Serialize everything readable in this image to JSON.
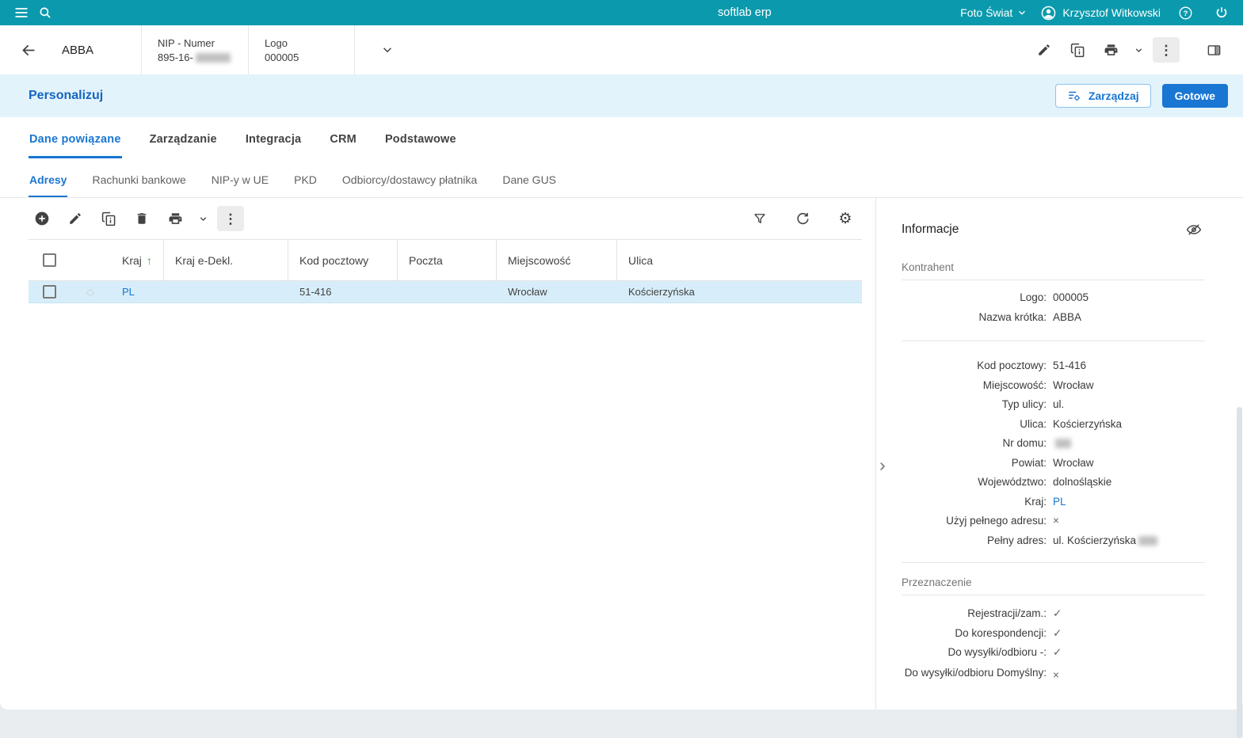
{
  "accent": "#1976d2",
  "topbar": {
    "app_title": "softlab erp",
    "company_selector": "Foto Świat",
    "user_name": "Krzysztof Witkowski"
  },
  "header": {
    "title": "ABBA",
    "nip": {
      "label": "NIP - Numer",
      "value_visible": "895-16-"
    },
    "logo": {
      "label": "Logo",
      "value": "000005"
    }
  },
  "personalize_bar": {
    "title": "Personalizuj",
    "manage_button": "Zarządzaj",
    "done_button": "Gotowe"
  },
  "main_tabs": [
    {
      "label": "Dane powiązane",
      "active": true
    },
    {
      "label": "Zarządzanie",
      "active": false
    },
    {
      "label": "Integracja",
      "active": false
    },
    {
      "label": "CRM",
      "active": false
    },
    {
      "label": "Podstawowe",
      "active": false
    }
  ],
  "sub_tabs": [
    {
      "label": "Adresy",
      "active": true
    },
    {
      "label": "Rachunki bankowe",
      "active": false
    },
    {
      "label": "NIP-y w UE",
      "active": false
    },
    {
      "label": "PKD",
      "active": false
    },
    {
      "label": "Odbiorcy/dostawcy płatnika",
      "active": false
    },
    {
      "label": "Dane GUS",
      "active": false
    }
  ],
  "table": {
    "headers": {
      "kraj": "Kraj",
      "kraj_edekl": "Kraj e-Dekl.",
      "kod_pocztowy": "Kod pocztowy",
      "poczta": "Poczta",
      "miejscowosc": "Miejscowość",
      "ulica": "Ulica"
    },
    "sort_arrow": "↑",
    "rows": [
      {
        "kraj": "PL",
        "kraj_edekl": "",
        "kod_pocztowy": "51-416",
        "poczta": "",
        "miejscowosc": "Wrocław",
        "ulica": "Kościerzyńska"
      }
    ]
  },
  "info_panel": {
    "title": "Informacje",
    "sections": {
      "kontrahent_title": "Kontrahent",
      "przeznaczenie_title": "Przeznaczenie"
    },
    "kontrahent": [
      {
        "label": "Logo:",
        "value": "000005"
      },
      {
        "label": "Nazwa krótka:",
        "value": "ABBA"
      }
    ],
    "adres": [
      {
        "label": "Kod pocztowy:",
        "value": "51-416"
      },
      {
        "label": "Miejscowość:",
        "value": "Wrocław"
      },
      {
        "label": "Typ ulicy:",
        "value": "ul."
      },
      {
        "label": "Ulica:",
        "value": "Kościerzyńska"
      },
      {
        "label": "Nr domu:",
        "value": ""
      },
      {
        "label": "Powiat:",
        "value": "Wrocław"
      },
      {
        "label": "Województwo:",
        "value": "dolnośląskie"
      },
      {
        "label": "Kraj:",
        "value": "PL"
      },
      {
        "label": "Użyj pełnego adresu:",
        "value": "×"
      },
      {
        "label": "Pełny adres:",
        "value": "ul. Kościerzyńska"
      }
    ],
    "przeznaczenie": [
      {
        "label": "Rejestracji/zam.:",
        "value": "✓"
      },
      {
        "label": "Do korespondencji:",
        "value": "✓"
      },
      {
        "label": "Do wysyłki/odbioru -:",
        "value": "✓"
      },
      {
        "label": "Do wysyłki/odbioru Domyślny:",
        "value": "×"
      }
    ]
  }
}
